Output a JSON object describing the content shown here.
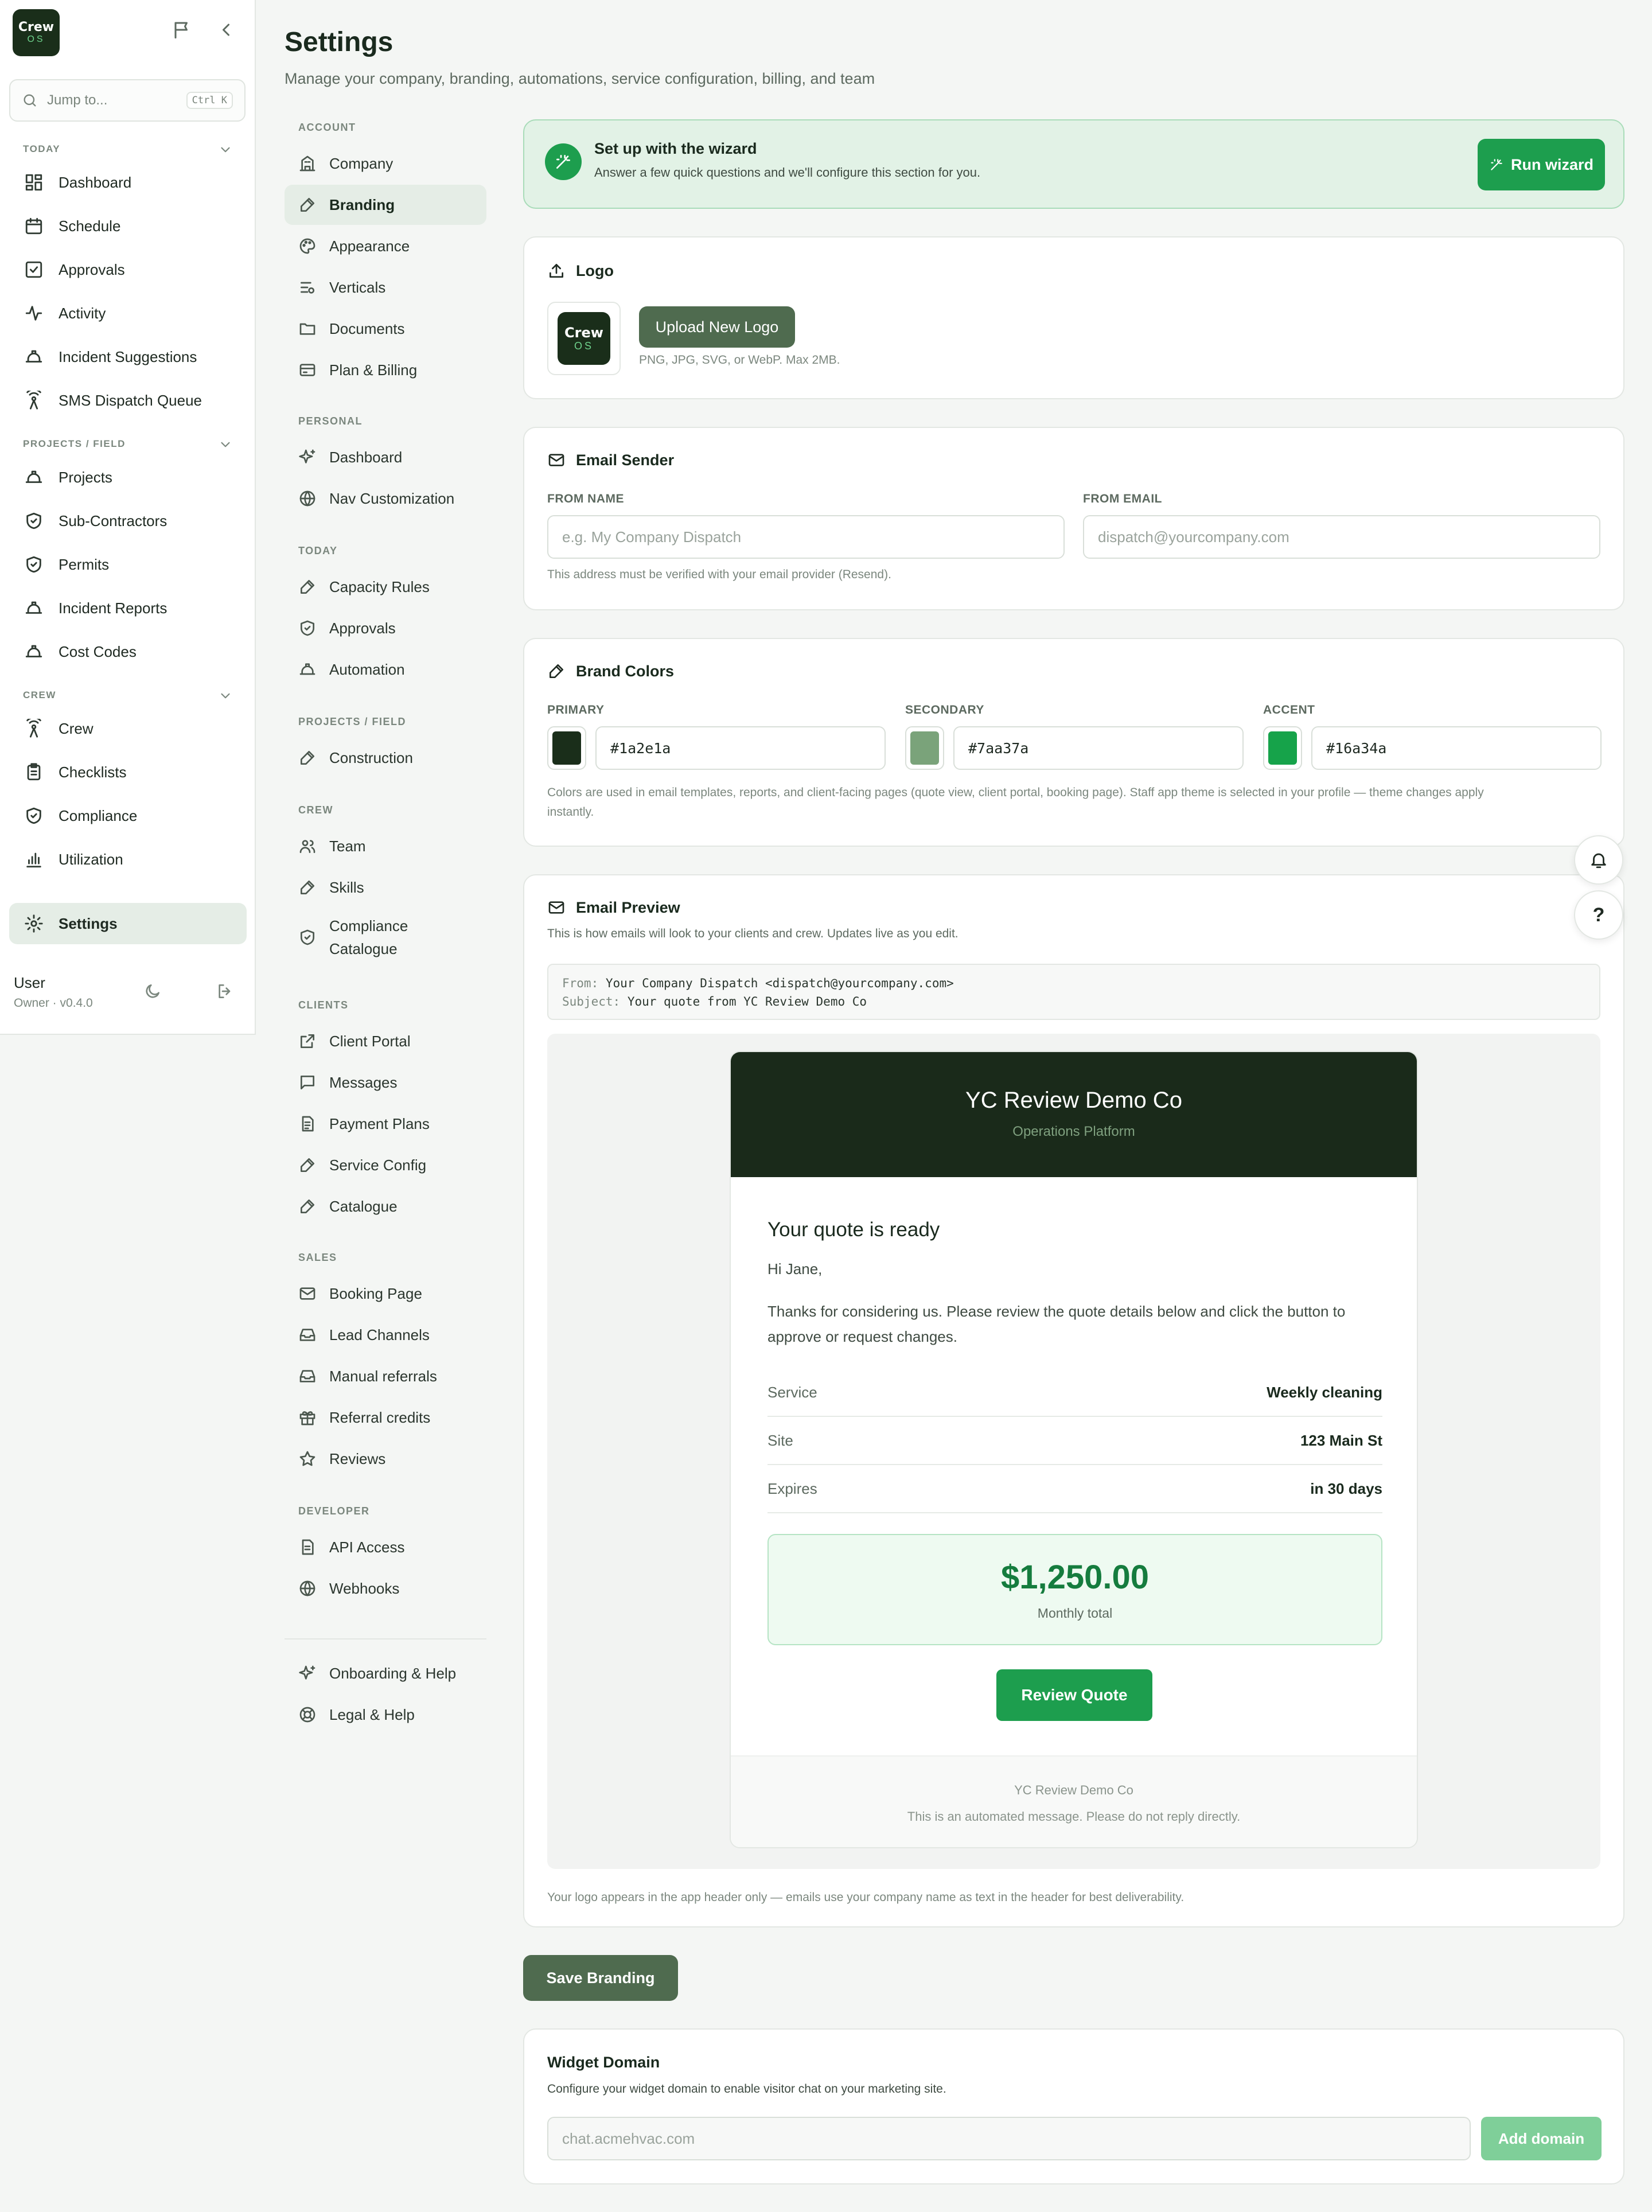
{
  "sidebar": {
    "logo_line1": "Crew",
    "logo_line2": "OS",
    "search_placeholder": "Jump to...",
    "search_shortcut": "Ctrl K",
    "sections": [
      {
        "label": "TODAY",
        "items": [
          {
            "label": "Dashboard",
            "icon": "dashboard-icon"
          },
          {
            "label": "Schedule",
            "icon": "calendar-icon"
          },
          {
            "label": "Approvals",
            "icon": "check-square-icon"
          },
          {
            "label": "Activity",
            "icon": "activity-icon"
          },
          {
            "label": "Incident Suggestions",
            "icon": "hard-hat-icon"
          },
          {
            "label": "SMS Dispatch Queue",
            "icon": "radio-icon"
          }
        ]
      },
      {
        "label": "PROJECTS / FIELD",
        "items": [
          {
            "label": "Projects",
            "icon": "hard-hat-icon"
          },
          {
            "label": "Sub-Contractors",
            "icon": "shield-icon"
          },
          {
            "label": "Permits",
            "icon": "shield-icon"
          },
          {
            "label": "Incident Reports",
            "icon": "hard-hat-icon"
          },
          {
            "label": "Cost Codes",
            "icon": "hard-hat-icon"
          }
        ]
      },
      {
        "label": "CREW",
        "items": [
          {
            "label": "Crew",
            "icon": "radio-icon"
          },
          {
            "label": "Checklists",
            "icon": "clipboard-icon"
          },
          {
            "label": "Compliance",
            "icon": "shield-icon"
          },
          {
            "label": "Utilization",
            "icon": "bar-chart-icon"
          }
        ]
      }
    ],
    "settings_label": "Settings",
    "user_name": "User",
    "user_role": "Owner · v0.4.0"
  },
  "header": {
    "title": "Settings",
    "subtitle": "Manage your company, branding, automations, service configuration, billing, and team"
  },
  "settings_nav": {
    "account_label": "ACCOUNT",
    "account": [
      "Company",
      "Branding",
      "Appearance",
      "Verticals",
      "Documents",
      "Plan & Billing"
    ],
    "personal_label": "PERSONAL",
    "personal": [
      "Dashboard",
      "Nav Customization"
    ],
    "today_label": "TODAY",
    "today": [
      "Capacity Rules",
      "Approvals",
      "Automation"
    ],
    "projects_label": "PROJECTS / FIELD",
    "projects": [
      "Construction"
    ],
    "crew_label": "CREW",
    "crew": [
      "Team",
      "Skills",
      "Compliance Catalogue"
    ],
    "clients_label": "CLIENTS",
    "clients": [
      "Client Portal",
      "Messages",
      "Payment Plans",
      "Service Config",
      "Catalogue"
    ],
    "sales_label": "SALES",
    "sales": [
      "Booking Page",
      "Lead Channels",
      "Manual referrals",
      "Referral credits",
      "Reviews"
    ],
    "developer_label": "DEVELOPER",
    "developer": [
      "API Access",
      "Webhooks"
    ],
    "footer": [
      "Onboarding & Help",
      "Legal & Help"
    ]
  },
  "wizard": {
    "title": "Set up with the wizard",
    "subtitle": "Answer a few quick questions and we'll configure this section for you.",
    "button": "Run wizard"
  },
  "logo_card": {
    "title": "Logo",
    "upload_button": "Upload New Logo",
    "hint": "PNG, JPG, SVG, or WebP. Max 2MB."
  },
  "email_sender": {
    "title": "Email Sender",
    "from_name_label": "FROM NAME",
    "from_name_placeholder": "e.g. My Company Dispatch",
    "from_email_label": "FROM EMAIL",
    "from_email_placeholder": "dispatch@yourcompany.com",
    "hint": "This address must be verified with your email provider (Resend)."
  },
  "brand_colors": {
    "title": "Brand Colors",
    "primary_label": "PRIMARY",
    "primary": "#1a2e1a",
    "secondary_label": "SECONDARY",
    "secondary": "#7aa37a",
    "accent_label": "ACCENT",
    "accent": "#16a34a",
    "hint_1": "Colors are used in email templates, reports, and client-facing pages (quote view, client portal, booking page). Staff app theme is selected in your profile — theme changes apply",
    "hint_2": "instantly."
  },
  "email_preview": {
    "title": "Email Preview",
    "subtitle": "This is how emails will look to your clients and crew. Updates live as you edit.",
    "from_key": "From:",
    "from_value": "Your Company Dispatch <dispatch@yourcompany.com>",
    "subject_key": "Subject:",
    "subject_value": "Your quote from YC Review Demo Co",
    "company": "YC Review Demo Co",
    "platform": "Operations Platform",
    "heading": "Your quote is ready",
    "greeting": "Hi Jane,",
    "body": "Thanks for considering us. Please review the quote details below and click the button to approve or request changes.",
    "rows": [
      {
        "k": "Service",
        "v": "Weekly cleaning"
      },
      {
        "k": "Site",
        "v": "123 Main St"
      },
      {
        "k": "Expires",
        "v": "in 30 days"
      }
    ],
    "total": "$1,250.00",
    "total_label": "Monthly total",
    "cta": "Review Quote",
    "footer_company": "YC Review Demo Co",
    "footer_note": "This is an automated message. Please do not reply directly.",
    "hint": "Your logo appears in the app header only — emails use your company name as text in the header for best deliverability."
  },
  "save_button": "Save Branding",
  "widget_domain": {
    "title": "Widget Domain",
    "subtitle": "Configure your widget domain to enable visitor chat on your marketing site.",
    "placeholder": "chat.acmehvac.com",
    "button": "Add domain"
  },
  "float": {
    "help": "?"
  }
}
